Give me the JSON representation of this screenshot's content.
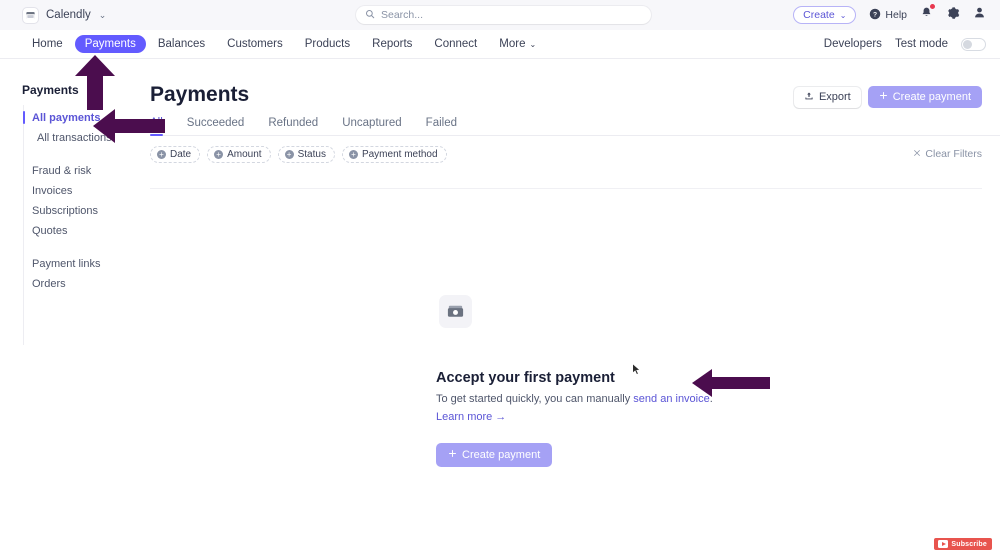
{
  "topbar": {
    "brand_name": "Calendly",
    "brand_caret": "⌄",
    "brand_icon": "calendar-card-icon",
    "search": {
      "placeholder": "Search...",
      "value": "",
      "icon": "search-icon"
    },
    "create_label": "Create",
    "create_caret": "⌄",
    "help_label": "Help",
    "help_icon": "help-circle-icon",
    "bell_icon": "notification-bell-icon",
    "bell_has_badge": true,
    "settings_icon": "gear-icon",
    "account_icon": "person-icon"
  },
  "nav": {
    "items": [
      {
        "label": "Home",
        "active": false,
        "caret": ""
      },
      {
        "label": "Payments",
        "active": true,
        "caret": ""
      },
      {
        "label": "Balances",
        "active": false,
        "caret": ""
      },
      {
        "label": "Customers",
        "active": false,
        "caret": ""
      },
      {
        "label": "Products",
        "active": false,
        "caret": ""
      },
      {
        "label": "Reports",
        "active": false,
        "caret": ""
      },
      {
        "label": "Connect",
        "active": false,
        "caret": ""
      },
      {
        "label": "More",
        "active": false,
        "caret": "⌄"
      }
    ],
    "developers_label": "Developers",
    "test_mode_label": "Test mode",
    "test_mode_on": false
  },
  "sidebar": {
    "title": "Payments",
    "items": [
      {
        "label": "All payments",
        "active": true,
        "sub": false
      },
      {
        "label": "All transactions",
        "active": false,
        "sub": true
      },
      {
        "label": "Fraud & risk",
        "active": false,
        "sub": false
      },
      {
        "label": "Invoices",
        "active": false,
        "sub": false
      },
      {
        "label": "Subscriptions",
        "active": false,
        "sub": false
      },
      {
        "label": "Quotes",
        "active": false,
        "sub": false
      },
      {
        "label": "Payment links",
        "active": false,
        "sub": false
      },
      {
        "label": "Orders",
        "active": false,
        "sub": false
      }
    ]
  },
  "main": {
    "title": "Payments",
    "export_label": "Export",
    "export_icon": "upload-icon",
    "create_payment_label": "Create payment",
    "create_payment_icon": "plus-icon",
    "tabs": [
      {
        "label": "All",
        "active": true
      },
      {
        "label": "Succeeded",
        "active": false
      },
      {
        "label": "Refunded",
        "active": false
      },
      {
        "label": "Uncaptured",
        "active": false
      },
      {
        "label": "Failed",
        "active": false
      }
    ],
    "filters": [
      {
        "label": "Date"
      },
      {
        "label": "Amount"
      },
      {
        "label": "Status"
      },
      {
        "label": "Payment method"
      }
    ],
    "clear_filters_label": "Clear Filters",
    "clear_filters_icon": "close-x-icon"
  },
  "empty_state": {
    "icon": "wallet-card-icon",
    "title": "Accept your first payment",
    "description_prefix": "To get started quickly, you can manually ",
    "description_link": "send an invoice",
    "description_suffix": ".",
    "learn_more_label": "Learn more →",
    "button_label": "Create payment",
    "button_icon": "plus-icon"
  },
  "overlay": {
    "subscribe_label": "Subscribe",
    "subscribe_icon": "youtube-play-icon",
    "arrow_color": "#4b0d4e",
    "annotations": [
      {
        "name": "arrow-up-payments-nav",
        "direction": "up"
      },
      {
        "name": "arrow-left-all-payments",
        "direction": "left"
      },
      {
        "name": "arrow-left-send-invoice",
        "direction": "left"
      }
    ]
  },
  "colors": {
    "accent_purple": "#635bff",
    "accent_purple_light": "#a5a1f5",
    "link_purple": "#5b55d6",
    "badge_red": "#e8384f",
    "subscribe_red": "#e8544e",
    "topbar_bg": "#f7f7fa"
  }
}
